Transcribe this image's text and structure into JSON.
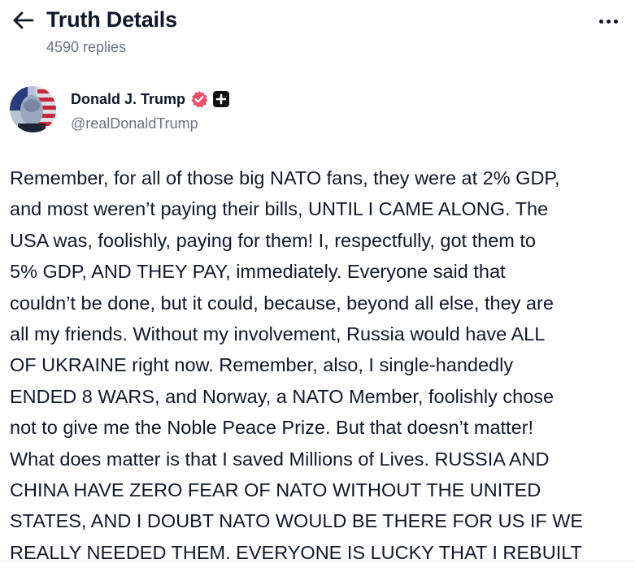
{
  "header": {
    "title": "Truth Details",
    "replies": "4590 replies",
    "back_icon": "arrow-left-icon",
    "more_icon": "ellipsis-horizontal-icon"
  },
  "author": {
    "display_name": "Donald J. Trump",
    "handle": "@realDonaldTrump",
    "verified_color": "#ef4f68",
    "badge_icon": "plus-square-icon"
  },
  "post": {
    "lines": [
      "Remember, for all of those big NATO fans, they were at 2% GDP,",
      "and most weren’t paying their bills, UNTIL I CAME ALONG. The",
      "USA was, foolishly, paying for them! I, respectfully, got them to",
      "5% GDP, AND THEY PAY, immediately. Everyone said that",
      "couldn’t be done, but it could, because, beyond all else, they are",
      "all my friends. Without my involvement, Russia would have ALL",
      "OF UKRAINE right now. Remember, also, I single-handedly",
      "ENDED 8 WARS, and Norway, a NATO Member, foolishly chose",
      "not to give me the Noble Peace Prize. But that doesn’t matter!",
      "What does matter is that I saved Millions of Lives. RUSSIA AND",
      "CHINA HAVE ZERO FEAR OF NATO WITHOUT THE UNITED",
      "STATES, AND I DOUBT NATO WOULD BE THERE FOR US IF WE",
      "REALLY NEEDED THEM. EVERYONE IS LUCKY THAT I REBUILT"
    ]
  }
}
